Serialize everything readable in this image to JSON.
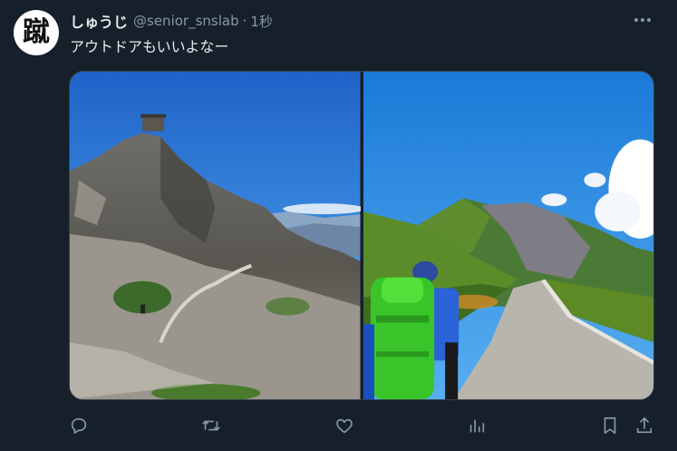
{
  "tweet": {
    "avatar_glyph": "蹴",
    "display_name": "しゅうじ",
    "handle": "@senior_snslab",
    "separator": "·",
    "time": "1秒",
    "text": "アウトドアもいいよなー"
  },
  "media": {
    "photos": [
      {
        "subject": "rocky mountain summit with hut under blue sky"
      },
      {
        "subject": "hiker with green backpack on gravel road toward green mountain"
      }
    ]
  },
  "icons": {
    "more": "more-horizontal-icon",
    "reply": "reply-icon",
    "retweet": "retweet-icon",
    "like": "heart-icon",
    "views": "analytics-icon",
    "bookmark": "bookmark-icon",
    "share": "share-icon"
  },
  "colors": {
    "background": "#15202b",
    "text": "#e7e9ea",
    "muted": "#8b98a5",
    "border": "#38444d"
  }
}
